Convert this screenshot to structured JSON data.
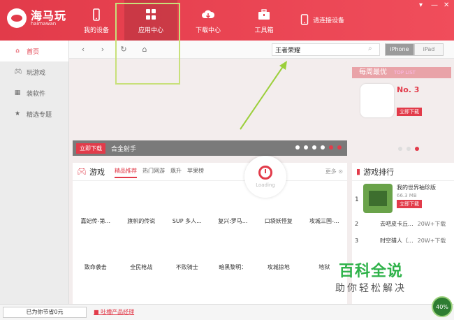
{
  "app": {
    "logo_cn": "海马玩",
    "logo_en": "haimawan"
  },
  "nav": [
    {
      "label": "我的设备",
      "icon": "phone-icon"
    },
    {
      "label": "应用中心",
      "icon": "grid-icon"
    },
    {
      "label": "下载中心",
      "icon": "cloud-download-icon"
    },
    {
      "label": "工具箱",
      "icon": "toolbox-icon"
    }
  ],
  "device_status": "请连接设备",
  "sidebar": {
    "items": [
      {
        "label": "首页",
        "icon": "home-icon"
      },
      {
        "label": "玩游戏",
        "icon": "gamepad-icon"
      },
      {
        "label": "装软件",
        "icon": "apps-icon"
      },
      {
        "label": "精选专题",
        "icon": "star-icon"
      }
    ]
  },
  "search": {
    "value": "王者荣耀"
  },
  "device_toggle": {
    "options": [
      "iPhone",
      "iPad"
    ],
    "selected": "iPhone"
  },
  "banner": {
    "download": "立即下载",
    "title": "合金射手"
  },
  "weekly": {
    "title": "每周最优",
    "subtitle": "TOP LIST",
    "rank": "No. 3",
    "download": "立即下载"
  },
  "games": {
    "title": "游戏",
    "tabs": [
      "精品推荐",
      "热门网游",
      "飙升",
      "苹果榜"
    ],
    "more": "更多",
    "loading": "Loading",
    "row1": [
      "嘉妃传-第...",
      "旗帜的传说",
      "SUP 多人...",
      "复兴:罗马...",
      "口袋妖怪复",
      "攻城三国-..."
    ],
    "row2": [
      "致命袭击",
      "全民枪战",
      "不败骑士",
      "暗黑黎明：",
      "攻城掠地",
      "地狱"
    ]
  },
  "ranking": {
    "title": "游戏排行",
    "top": {
      "name": "我的世界袖珍版",
      "size": "66.3 MB",
      "download": "立即下载"
    },
    "rows": [
      {
        "n": "2",
        "title": "去吧皮卡丘...",
        "count": "20W+下载"
      },
      {
        "n": "3",
        "title": "时空猎人（...",
        "count": "20W+下载"
      }
    ]
  },
  "watermark": {
    "line1": "百科全说",
    "line2": "助你轻松解决"
  },
  "status": {
    "savings": "已为你节省0元",
    "feedback": "吐槽产品经理",
    "progress": "40%"
  },
  "colors": {
    "brand": "#e23b4a",
    "highlight": "#c8e07a",
    "arrow": "#9bcf3a"
  }
}
